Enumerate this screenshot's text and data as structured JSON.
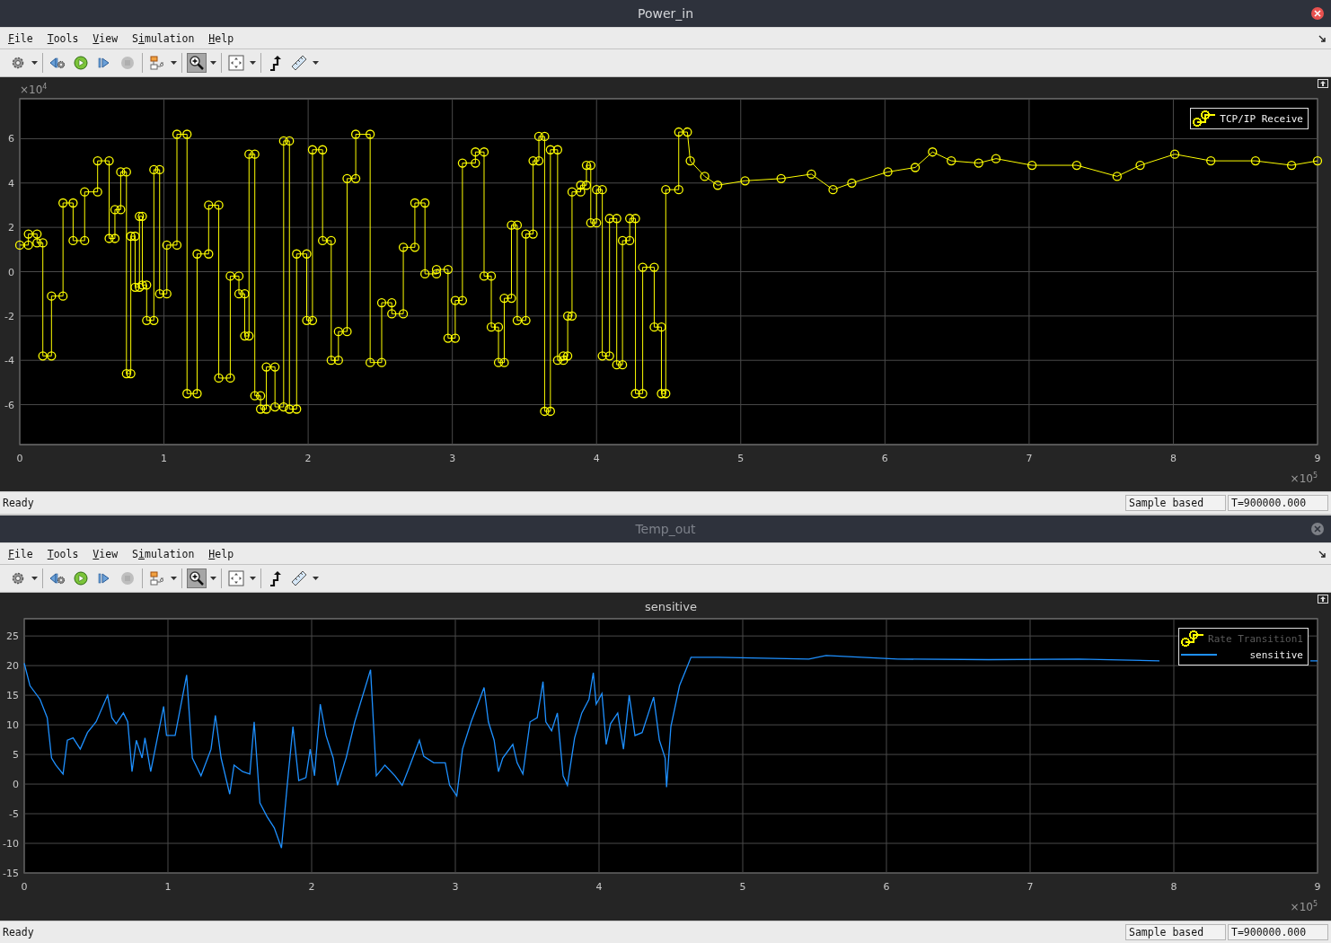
{
  "windows": [
    {
      "title": "Power_in",
      "active": true,
      "menu": [
        {
          "mnemonic": "F",
          "rest": "ile"
        },
        {
          "mnemonic": "T",
          "rest": "ools"
        },
        {
          "mnemonic": "V",
          "rest": "iew"
        },
        {
          "before": "S",
          "mnemonic": "i",
          "rest": "mulation"
        },
        {
          "mnemonic": "H",
          "rest": "elp"
        }
      ],
      "toolbar": [
        {
          "buttons": [
            {
              "kind": "settings",
              "dropdown": true,
              "selected": false,
              "disabled": false
            }
          ]
        },
        {
          "buttons": [
            {
              "kind": "step-back",
              "dropdown": false,
              "selected": false,
              "disabled": false
            },
            {
              "kind": "run",
              "dropdown": false,
              "selected": false,
              "disabled": false
            },
            {
              "kind": "step-forward",
              "dropdown": false,
              "selected": false,
              "disabled": false
            },
            {
              "kind": "stop",
              "dropdown": false,
              "selected": false,
              "disabled": true
            }
          ]
        },
        {
          "buttons": [
            {
              "kind": "highlight",
              "dropdown": true,
              "selected": false,
              "disabled": false
            }
          ]
        },
        {
          "buttons": [
            {
              "kind": "zoom",
              "dropdown": true,
              "selected": true,
              "disabled": false
            }
          ]
        },
        {
          "buttons": [
            {
              "kind": "fit",
              "dropdown": true,
              "selected": false,
              "disabled": false
            }
          ]
        },
        {
          "buttons": [
            {
              "kind": "signal",
              "dropdown": false,
              "selected": false,
              "disabled": false
            },
            {
              "kind": "ruler",
              "dropdown": true,
              "selected": false,
              "disabled": false
            }
          ]
        }
      ],
      "plot": {
        "y_multiplier": {
          "base": "×10",
          "exponent": "4"
        },
        "x_multiplier": {
          "base": "×10",
          "exponent": "5"
        },
        "legend": [
          {
            "kind": "marker",
            "label": "TCP/IP Receive",
            "dimmed": false,
            "color": "#ffff00"
          }
        ],
        "chart_data": {
          "type": "line",
          "grid": true,
          "xlim": [
            0,
            9
          ],
          "ylim": [
            -7.8,
            7.8
          ],
          "xticks": [
            0,
            1,
            2,
            3,
            4,
            5,
            6,
            7,
            8,
            9
          ],
          "yticks": [
            -6,
            -4,
            -2,
            0,
            2,
            4,
            6
          ],
          "x": [
            0,
            0.06,
            0.06,
            0.12,
            0.12,
            0.16,
            0.16,
            0.22,
            0.22,
            0.3,
            0.3,
            0.37,
            0.37,
            0.45,
            0.45,
            0.54,
            0.54,
            0.62,
            0.62,
            0.66,
            0.66,
            0.7,
            0.7,
            0.74,
            0.74,
            0.77,
            0.77,
            0.8,
            0.8,
            0.83,
            0.83,
            0.85,
            0.85,
            0.88,
            0.88,
            0.93,
            0.93,
            0.97,
            0.97,
            1.02,
            1.02,
            1.09,
            1.09,
            1.16,
            1.16,
            1.23,
            1.23,
            1.31,
            1.31,
            1.38,
            1.38,
            1.46,
            1.46,
            1.52,
            1.52,
            1.56,
            1.56,
            1.59,
            1.59,
            1.63,
            1.63,
            1.67,
            1.67,
            1.71,
            1.71,
            1.77,
            1.77,
            1.83,
            1.83,
            1.87,
            1.87,
            1.92,
            1.92,
            1.99,
            1.99,
            2.03,
            2.03,
            2.1,
            2.1,
            2.16,
            2.16,
            2.21,
            2.21,
            2.27,
            2.27,
            2.33,
            2.33,
            2.43,
            2.43,
            2.51,
            2.51,
            2.58,
            2.58,
            2.66,
            2.66,
            2.74,
            2.74,
            2.81,
            2.81,
            2.89,
            2.89,
            2.97,
            2.97,
            3.02,
            3.02,
            3.07,
            3.07,
            3.16,
            3.16,
            3.22,
            3.22,
            3.27,
            3.27,
            3.32,
            3.32,
            3.36,
            3.36,
            3.41,
            3.41,
            3.45,
            3.45,
            3.51,
            3.51,
            3.56,
            3.56,
            3.6,
            3.6,
            3.64,
            3.64,
            3.68,
            3.68,
            3.73,
            3.73,
            3.77,
            3.77,
            3.8,
            3.8,
            3.83,
            3.83,
            3.89,
            3.89,
            3.93,
            3.93,
            3.96,
            3.96,
            4.0,
            4.0,
            4.04,
            4.04,
            4.09,
            4.09,
            4.14,
            4.14,
            4.18,
            4.18,
            4.23,
            4.23,
            4.27,
            4.27,
            4.32,
            4.32,
            4.4,
            4.4,
            4.45,
            4.45,
            4.48,
            4.48,
            4.57,
            4.57,
            4.63,
            4.65,
            4.75,
            4.84,
            5.03,
            5.28,
            5.49,
            5.64,
            5.77,
            6.02,
            6.21,
            6.33,
            6.46,
            6.65,
            6.77,
            7.02,
            7.33,
            7.61,
            7.77,
            8.01,
            8.26,
            8.57,
            8.82,
            9.0
          ],
          "series": [
            {
              "color": "#ffff00",
              "marker": "o",
              "values": [
                1.2,
                1.2,
                1.7,
                1.7,
                1.3,
                1.3,
                -3.8,
                -3.8,
                -1.1,
                -1.1,
                3.1,
                3.1,
                1.4,
                1.4,
                3.6,
                3.6,
                5.0,
                5.0,
                1.5,
                1.5,
                2.8,
                2.8,
                4.5,
                4.5,
                -4.6,
                -4.6,
                1.6,
                1.6,
                -0.7,
                -0.7,
                2.5,
                2.5,
                -0.6,
                -0.6,
                -2.2,
                -2.2,
                4.6,
                4.6,
                -1.0,
                -1.0,
                1.2,
                1.2,
                6.2,
                6.2,
                -5.5,
                -5.5,
                0.8,
                0.8,
                3.0,
                3.0,
                -4.8,
                -4.8,
                -0.2,
                -0.2,
                -1.0,
                -1.0,
                -2.9,
                -2.9,
                5.3,
                5.3,
                -5.6,
                -5.6,
                -6.2,
                -6.2,
                -4.3,
                -4.3,
                -6.1,
                -6.1,
                5.9,
                5.9,
                -6.2,
                -6.2,
                0.8,
                0.8,
                -2.2,
                -2.2,
                5.5,
                5.5,
                1.4,
                1.4,
                -4.0,
                -4.0,
                -2.7,
                -2.7,
                4.2,
                4.2,
                6.2,
                6.2,
                -4.1,
                -4.1,
                -1.4,
                -1.4,
                -1.9,
                -1.9,
                1.1,
                1.1,
                3.1,
                3.1,
                -0.1,
                -0.1,
                0.1,
                0.1,
                -3.0,
                -3.0,
                -1.3,
                -1.3,
                4.9,
                4.9,
                5.4,
                5.4,
                -0.2,
                -0.2,
                -2.5,
                -2.5,
                -4.1,
                -4.1,
                -1.2,
                -1.2,
                2.1,
                2.1,
                -2.2,
                -2.2,
                1.7,
                1.7,
                5.0,
                5.0,
                6.1,
                6.1,
                -6.3,
                -6.3,
                5.5,
                5.5,
                -4.0,
                -4.0,
                -3.8,
                -3.8,
                -2.0,
                -2.0,
                3.6,
                3.6,
                3.9,
                3.9,
                4.8,
                4.8,
                2.2,
                2.2,
                3.7,
                3.7,
                -3.8,
                -3.8,
                2.4,
                2.4,
                -4.2,
                -4.2,
                1.4,
                1.4,
                2.4,
                2.4,
                -5.5,
                -5.5,
                0.2,
                0.2,
                -2.5,
                -2.5,
                -5.5,
                -5.5,
                3.7,
                3.7,
                6.3,
                6.3,
                5.0,
                4.3,
                3.9,
                4.1,
                4.2,
                4.4,
                3.7,
                4.0,
                4.5,
                4.7,
                5.4,
                5.0,
                4.9,
                5.1,
                4.8,
                4.8,
                4.3,
                4.8,
                5.3,
                5.0,
                5.0,
                4.8,
                5.0
              ]
            }
          ]
        }
      },
      "status": {
        "message": "Ready",
        "fields": [
          "Sample based",
          "T=900000.000"
        ]
      }
    },
    {
      "title": "Temp_out",
      "active": false,
      "menu": [
        {
          "mnemonic": "F",
          "rest": "ile"
        },
        {
          "mnemonic": "T",
          "rest": "ools"
        },
        {
          "mnemonic": "V",
          "rest": "iew"
        },
        {
          "before": "S",
          "mnemonic": "i",
          "rest": "mulation"
        },
        {
          "mnemonic": "H",
          "rest": "elp"
        }
      ],
      "toolbar": [
        {
          "buttons": [
            {
              "kind": "settings",
              "dropdown": true,
              "selected": false,
              "disabled": false
            }
          ]
        },
        {
          "buttons": [
            {
              "kind": "step-back",
              "dropdown": false,
              "selected": false,
              "disabled": false
            },
            {
              "kind": "run",
              "dropdown": false,
              "selected": false,
              "disabled": false
            },
            {
              "kind": "step-forward",
              "dropdown": false,
              "selected": false,
              "disabled": false
            },
            {
              "kind": "stop",
              "dropdown": false,
              "selected": false,
              "disabled": true
            }
          ]
        },
        {
          "buttons": [
            {
              "kind": "highlight",
              "dropdown": true,
              "selected": false,
              "disabled": false
            }
          ]
        },
        {
          "buttons": [
            {
              "kind": "zoom",
              "dropdown": true,
              "selected": true,
              "disabled": false
            }
          ]
        },
        {
          "buttons": [
            {
              "kind": "fit",
              "dropdown": true,
              "selected": false,
              "disabled": false
            }
          ]
        },
        {
          "buttons": [
            {
              "kind": "signal",
              "dropdown": false,
              "selected": false,
              "disabled": false
            },
            {
              "kind": "ruler",
              "dropdown": true,
              "selected": false,
              "disabled": false
            }
          ]
        }
      ],
      "plot": {
        "x_multiplier": {
          "base": "×10",
          "exponent": "5"
        },
        "legend": [
          {
            "kind": "marker",
            "label": "Rate Transition1",
            "dimmed": true,
            "color": "#ffff00"
          },
          {
            "kind": "line",
            "label": "sensitive",
            "dimmed": false,
            "color": "#1e90ff"
          }
        ],
        "chart_data": {
          "type": "line",
          "grid": true,
          "title": "sensitive",
          "xlim": [
            0,
            9
          ],
          "ylim": [
            -15,
            27.9
          ],
          "xticks": [
            0,
            1,
            2,
            3,
            4,
            5,
            6,
            7,
            8,
            9
          ],
          "yticks": [
            -15,
            -10,
            -5,
            0,
            5,
            10,
            15,
            20,
            25
          ],
          "x": [
            0,
            0.04,
            0.11,
            0.16,
            0.19,
            0.22,
            0.27,
            0.3,
            0.34,
            0.39,
            0.44,
            0.5,
            0.58,
            0.61,
            0.64,
            0.69,
            0.72,
            0.75,
            0.78,
            0.82,
            0.84,
            0.88,
            0.97,
            0.99,
            1.05,
            1.13,
            1.17,
            1.23,
            1.3,
            1.33,
            1.37,
            1.43,
            1.46,
            1.52,
            1.57,
            1.6,
            1.64,
            1.69,
            1.74,
            1.79,
            1.83,
            1.87,
            1.91,
            1.96,
            1.99,
            2.02,
            2.06,
            2.1,
            2.15,
            2.18,
            2.24,
            2.3,
            2.41,
            2.45,
            2.51,
            2.58,
            2.63,
            2.68,
            2.75,
            2.78,
            2.85,
            2.93,
            2.96,
            3.01,
            3.05,
            3.11,
            3.2,
            3.23,
            3.27,
            3.3,
            3.33,
            3.4,
            3.43,
            3.47,
            3.52,
            3.57,
            3.61,
            3.63,
            3.67,
            3.71,
            3.75,
            3.78,
            3.83,
            3.88,
            3.93,
            3.96,
            3.98,
            4.02,
            4.05,
            4.08,
            4.13,
            4.17,
            4.21,
            4.25,
            4.3,
            4.38,
            4.42,
            4.46,
            4.47,
            4.5,
            4.56,
            4.64,
            4.83,
            5.46,
            5.58,
            6.08,
            6.71,
            7.34,
            7.9,
            8.59,
            8.95,
            9.0
          ],
          "series": [
            {
              "color": "#1e90ff",
              "values": [
                20.4,
                16.6,
                14.3,
                11.2,
                4.4,
                3.2,
                1.7,
                7.4,
                7.8,
                5.9,
                8.7,
                10.5,
                15.0,
                11.2,
                10.2,
                12.0,
                10.5,
                2.1,
                7.4,
                4.4,
                7.8,
                2.1,
                13.1,
                8.2,
                8.2,
                18.4,
                4.4,
                1.4,
                5.9,
                11.6,
                4.4,
                -1.7,
                3.2,
                2.1,
                1.7,
                10.5,
                -3.2,
                -5.5,
                -7.4,
                -10.8,
                -0.2,
                9.7,
                0.6,
                1.1,
                5.9,
                1.4,
                13.5,
                8.2,
                4.4,
                -0.2,
                4.4,
                10.5,
                19.3,
                1.4,
                3.2,
                1.4,
                -0.2,
                2.9,
                7.4,
                4.7,
                3.6,
                3.6,
                -0.2,
                -2.0,
                5.9,
                10.5,
                16.3,
                10.5,
                7.4,
                2.1,
                4.4,
                6.7,
                3.6,
                1.7,
                10.5,
                11.2,
                17.3,
                10.5,
                9.0,
                12.0,
                1.4,
                -0.2,
                7.8,
                12.0,
                14.3,
                18.8,
                13.5,
                15.3,
                6.7,
                10.2,
                12.0,
                5.9,
                15.0,
                8.2,
                8.7,
                14.7,
                7.4,
                4.4,
                -0.5,
                9.7,
                16.6,
                21.4,
                21.4,
                21.1,
                21.7,
                21.1,
                21.0,
                21.1,
                20.8,
                null,
                20.8,
                20.8
              ]
            }
          ]
        }
      },
      "status": {
        "message": "Ready",
        "fields": [
          "Sample based",
          "T=900000.000"
        ]
      }
    }
  ]
}
